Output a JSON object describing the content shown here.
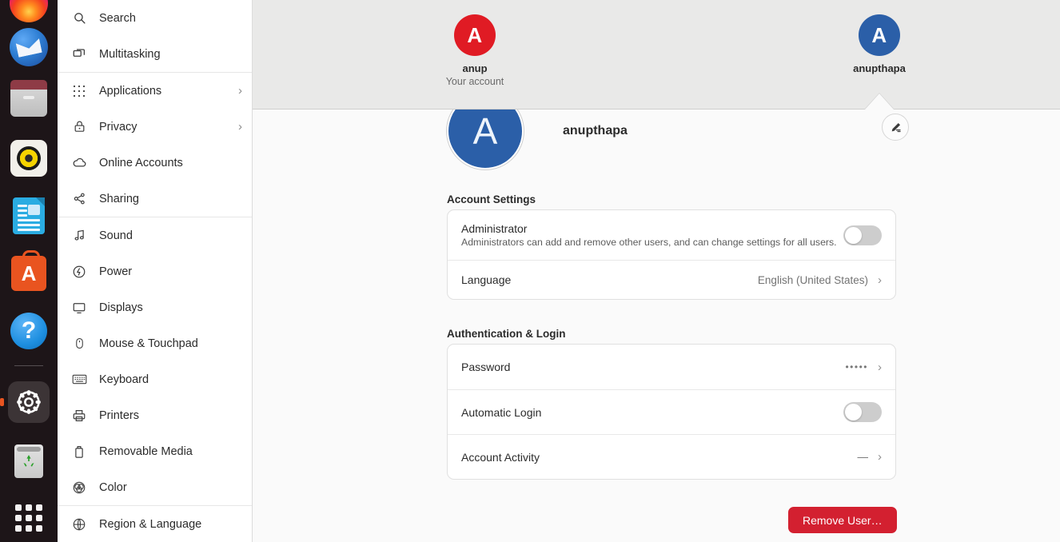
{
  "app": {
    "name": "Settings",
    "panel": "Users"
  },
  "dock": {
    "items": [
      {
        "name": "firefox",
        "label": "Firefox"
      },
      {
        "name": "thunderbird",
        "label": "Thunderbird Mail"
      },
      {
        "name": "files",
        "label": "Files"
      },
      {
        "name": "rhythmbox",
        "label": "Rhythmbox"
      },
      {
        "name": "libreoffice",
        "label": "LibreOffice Writer"
      },
      {
        "name": "ubuntu-software",
        "label": "Ubuntu Software",
        "glyph": "A"
      },
      {
        "name": "help",
        "label": "Help",
        "glyph": "?"
      },
      {
        "name": "settings",
        "label": "Settings"
      },
      {
        "name": "trash",
        "label": "Trash"
      },
      {
        "name": "show-applications",
        "label": "Show Applications"
      }
    ]
  },
  "sidebar": {
    "items": [
      {
        "label": "Search",
        "icon": "search-icon",
        "chevron": ""
      },
      {
        "label": "Multitasking",
        "icon": "multitasking-icon",
        "chevron": ""
      },
      {
        "label": "Applications",
        "icon": "applications-icon",
        "chevron": "›"
      },
      {
        "label": "Privacy",
        "icon": "lock-icon",
        "chevron": "›"
      },
      {
        "label": "Online Accounts",
        "icon": "cloud-icon",
        "chevron": ""
      },
      {
        "label": "Sharing",
        "icon": "share-icon",
        "chevron": ""
      },
      {
        "label": "Sound",
        "icon": "music-note-icon",
        "chevron": ""
      },
      {
        "label": "Power",
        "icon": "power-icon",
        "chevron": ""
      },
      {
        "label": "Displays",
        "icon": "display-icon",
        "chevron": ""
      },
      {
        "label": "Mouse & Touchpad",
        "icon": "mouse-icon",
        "chevron": ""
      },
      {
        "label": "Keyboard",
        "icon": "keyboard-icon",
        "chevron": ""
      },
      {
        "label": "Printers",
        "icon": "printer-icon",
        "chevron": ""
      },
      {
        "label": "Removable Media",
        "icon": "usb-drive-icon",
        "chevron": ""
      },
      {
        "label": "Color",
        "icon": "color-icon",
        "chevron": ""
      },
      {
        "label": "Region & Language",
        "icon": "globe-icon",
        "chevron": ""
      }
    ]
  },
  "users": {
    "list": [
      {
        "initial": "A",
        "name": "anup",
        "subtitle": "Your account",
        "color": "#e01b24",
        "selected": false
      },
      {
        "initial": "A",
        "name": "anupthapa",
        "subtitle": "",
        "color": "#2b5fa8",
        "selected": true
      }
    ]
  },
  "profile": {
    "initial": "A",
    "name": "anupthapa",
    "avatar_color": "#2b5fa8",
    "edit_icon": "pencil-icon"
  },
  "account_settings": {
    "title": "Account Settings",
    "rows": [
      {
        "title": "Administrator",
        "subtitle": "Administrators can add and remove other users, and can change settings for all users.",
        "control": "toggle",
        "value": "off"
      },
      {
        "title": "Language",
        "subtitle": "",
        "control": "chevron",
        "value": "English (United States)",
        "chevron": "›"
      }
    ]
  },
  "authentication": {
    "title": "Authentication & Login",
    "rows": [
      {
        "title": "Password",
        "control": "chevron",
        "value": "•••••",
        "chevron": "›"
      },
      {
        "title": "Automatic Login",
        "control": "toggle",
        "value": "off"
      },
      {
        "title": "Account Activity",
        "control": "chevron",
        "value": "—",
        "chevron": "›"
      }
    ]
  },
  "actions": {
    "remove_user_label": "Remove User…",
    "remove_user_color": "#d32030"
  }
}
